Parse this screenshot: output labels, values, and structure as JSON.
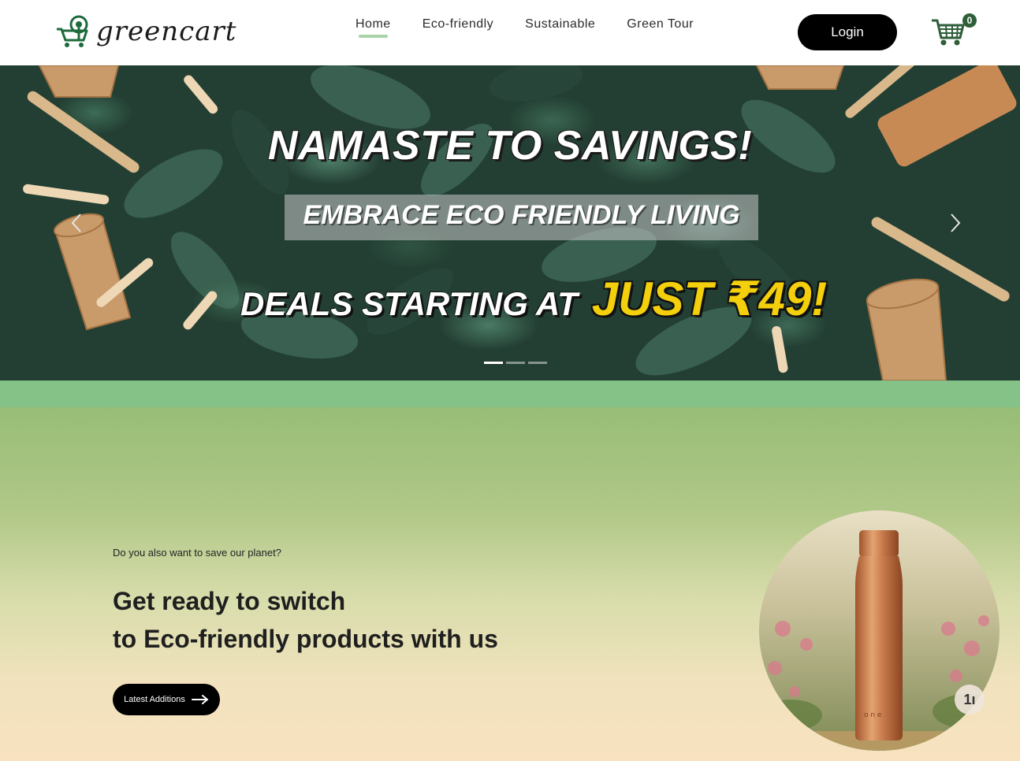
{
  "brand": {
    "name": "greencart"
  },
  "nav": {
    "links": [
      {
        "label": "Home",
        "active": true
      },
      {
        "label": "Eco-friendly",
        "active": false
      },
      {
        "label": "Sustainable",
        "active": false
      },
      {
        "label": "Green Tour",
        "active": false
      }
    ],
    "login_label": "Login",
    "cart_count": "0"
  },
  "hero": {
    "title": "NAMASTE TO SAVINGS!",
    "subtitle": "EMBRACE ECO FRIENDLY LIVING",
    "deals_text": "DEALS STARTING AT",
    "deals_price": "JUST ₹49!",
    "slide_count": 3,
    "active_slide": 1,
    "prev_icon": "chevron-left-icon",
    "next_icon": "chevron-right-icon"
  },
  "promo": {
    "question": "Do you also want to save our planet?",
    "headline_line1": "Get ready to switch",
    "headline_line2": "to Eco-friendly products with us",
    "button_label": "Latest Additions",
    "button_icon": "arrow-right-icon",
    "photo_badge": "1ı"
  },
  "colors": {
    "accent_green": "#84c287",
    "nav_underline": "#a9d4a7",
    "price_yellow": "#f3cf0c",
    "badge_green": "#2f5e3a",
    "button_black": "#000000"
  }
}
